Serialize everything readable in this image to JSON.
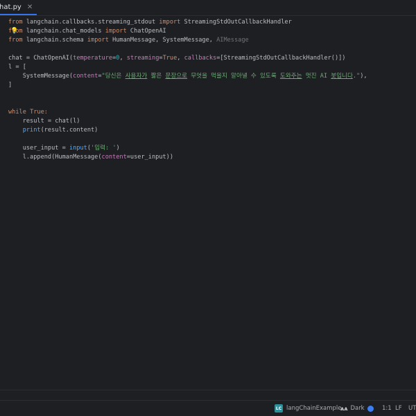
{
  "tab": {
    "label": "hat.py",
    "close": "✕"
  },
  "code_lines": [
    [
      {
        "t": "from",
        "c": "kw"
      },
      {
        "t": " langchain.callbacks.streaming_stdout "
      },
      {
        "t": "import",
        "c": "kw"
      },
      {
        "t": " StreamingStdOutCallbackHandler"
      }
    ],
    [
      {
        "t": "from",
        "c": "kw"
      },
      {
        "t": " langchain.chat_models "
      },
      {
        "t": "import",
        "c": "kw"
      },
      {
        "t": " ChatOpenAI"
      }
    ],
    [
      {
        "t": "from",
        "c": "kw"
      },
      {
        "t": " langchain.schema "
      },
      {
        "t": "import",
        "c": "kw"
      },
      {
        "t": " HumanMessage, SystemMessage, "
      },
      {
        "t": "AIMessage",
        "c": "muted"
      }
    ],
    [],
    [
      {
        "t": "chat = ChatOpenAI("
      },
      {
        "t": "temperature",
        "c": "param"
      },
      {
        "t": "="
      },
      {
        "t": "0",
        "c": "num"
      },
      {
        "t": ", "
      },
      {
        "t": "streaming",
        "c": "param"
      },
      {
        "t": "="
      },
      {
        "t": "True",
        "c": "kw"
      },
      {
        "t": ", "
      },
      {
        "t": "callbacks",
        "c": "param"
      },
      {
        "t": "=[StreamingStdOutCallbackHandler()])"
      }
    ],
    [
      {
        "t": "l = ["
      }
    ],
    [
      {
        "t": "    SystemMessage("
      },
      {
        "t": "content",
        "c": "param"
      },
      {
        "t": "="
      },
      {
        "t": "\"당신은 ",
        "c": "str"
      },
      {
        "t": "사용자가",
        "c": "str ul"
      },
      {
        "t": " 짧은 ",
        "c": "str"
      },
      {
        "t": "문장으로",
        "c": "str ul"
      },
      {
        "t": " 무엇을 먹을지 알아낼 수 있도록 ",
        "c": "str"
      },
      {
        "t": "도와주는",
        "c": "str ul"
      },
      {
        "t": " 멋진 AI ",
        "c": "str"
      },
      {
        "t": "봇입니다",
        "c": "str ul"
      },
      {
        "t": ".\"",
        "c": "str"
      },
      {
        "t": "),"
      }
    ],
    [
      {
        "t": "]"
      }
    ],
    [],
    [],
    [
      {
        "t": "while",
        "c": "kw"
      },
      {
        "t": " "
      },
      {
        "t": "True",
        "c": "kw"
      },
      {
        "t": ":",
        "c": "kw"
      }
    ],
    [
      {
        "t": "    result = chat(l)"
      }
    ],
    [
      {
        "t": "    "
      },
      {
        "t": "print",
        "c": "fn"
      },
      {
        "t": "(result.content)"
      }
    ],
    [],
    [
      {
        "t": "    user_input = "
      },
      {
        "t": "input",
        "c": "fn"
      },
      {
        "t": "("
      },
      {
        "t": "'입력: '",
        "c": "str"
      },
      {
        "t": ")"
      }
    ],
    [
      {
        "t": "    l.append(HumanMessage("
      },
      {
        "t": "content",
        "c": "param"
      },
      {
        "t": "=user_input))"
      }
    ]
  ],
  "colors": {
    "background": "#1e1f22",
    "keyword": "#cf8e6d",
    "param": "#c77dbb",
    "number": "#2aacb8",
    "string": "#6aab73",
    "builtin": "#57aaf7",
    "accent": "#3574f0"
  },
  "statusbar": {
    "project_badge": "LC",
    "project": "langChainExample",
    "theme": "Dark",
    "position": "1:1",
    "line_ending": "LF",
    "encoding": "UT"
  }
}
